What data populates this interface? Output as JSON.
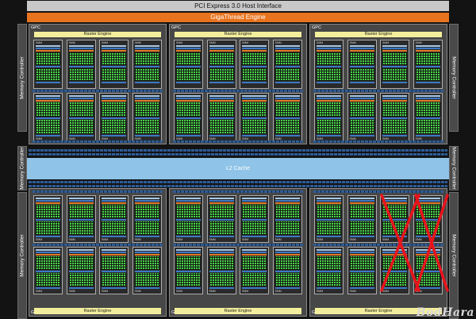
{
  "pci_express": {
    "label": "PCI Express 3.0 Host Interface"
  },
  "gigathread": {
    "label": "GigaThread Engine"
  },
  "memory_controller": {
    "label": "Memory Controller"
  },
  "gpc": {
    "label": "GPC"
  },
  "raster_engine": {
    "label": "Raster Engine"
  },
  "l2_cache": {
    "label": "L2 Cache"
  },
  "smm": {
    "label": "SMM"
  },
  "colors": {
    "host_interface": "#c9c9c9",
    "gigathread": "#e8731e",
    "raster_engine": "#f3ee9c",
    "l2_cache": "#8fc3e7",
    "cores": "#47d247",
    "disabled_mark": "#e8141b"
  },
  "annotation": {
    "icon": "red-cross-icon",
    "meaning": "disabled SMMs (two)"
  },
  "watermark": {
    "text": "BodHara"
  }
}
